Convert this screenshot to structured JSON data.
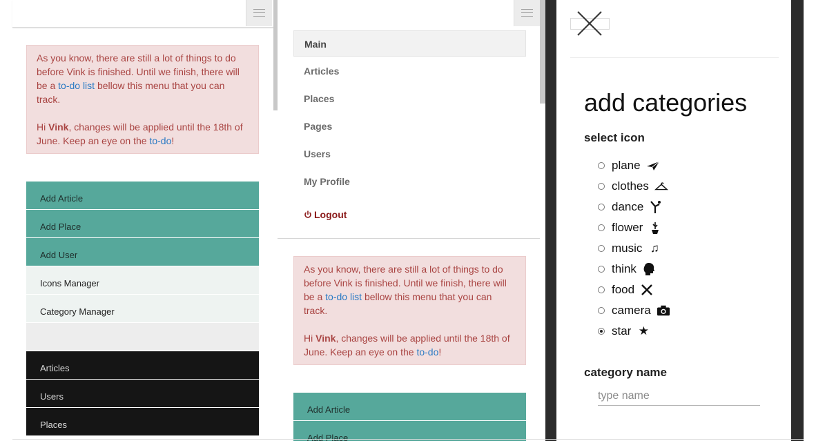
{
  "panel1": {
    "alert": {
      "line1_prefix": "As you know, there are still a lot of things to do before Vink is finished. Until we finish, there will be a ",
      "todo_link": "to-do list",
      "line1_suffix": " bellow this menu that you can track.",
      "line2_prefix": "Hi ",
      "user": "Vink",
      "line2_mid": ", changes will be applied until the 18th of June. Keep an eye on the ",
      "todo_link2": "to-do",
      "line2_suffix": "!"
    },
    "actions": [
      "Add Article",
      "Add Place",
      "Add User"
    ],
    "managers": [
      "Icons Manager",
      "Category Manager"
    ],
    "dark_items": [
      "Articles",
      "Users",
      "Places"
    ]
  },
  "panel2": {
    "nav": {
      "main": "Main",
      "articles": "Articles",
      "places": "Places",
      "pages": "Pages",
      "users": "Users",
      "profile": "My Profile",
      "logout": "Logout"
    },
    "actions": [
      "Add Article",
      "Add Place"
    ]
  },
  "panel3": {
    "title": "add categories",
    "select_icon_label": "select icon",
    "icons": [
      {
        "label": "plane",
        "icon": "plane-icon",
        "checked": false
      },
      {
        "label": "clothes",
        "icon": "hanger-icon",
        "checked": false
      },
      {
        "label": "dance",
        "icon": "dancer-icon",
        "checked": false
      },
      {
        "label": "flower",
        "icon": "flower-icon",
        "checked": false
      },
      {
        "label": "music",
        "icon": "music-note-icon",
        "checked": false
      },
      {
        "label": "think",
        "icon": "head-icon",
        "checked": false
      },
      {
        "label": "food",
        "icon": "cutlery-icon",
        "checked": false
      },
      {
        "label": "camera",
        "icon": "camera-icon",
        "checked": false
      },
      {
        "label": "star",
        "icon": "star-icon",
        "checked": true
      }
    ],
    "category_name_label": "category name",
    "category_name_placeholder": "type name"
  },
  "colors": {
    "teal": "#56a89b",
    "alert_bg": "#f2dede",
    "alert_text": "#a94442",
    "link": "#2a7ac4",
    "dark": "#151515",
    "logout": "#8b1a1a"
  }
}
